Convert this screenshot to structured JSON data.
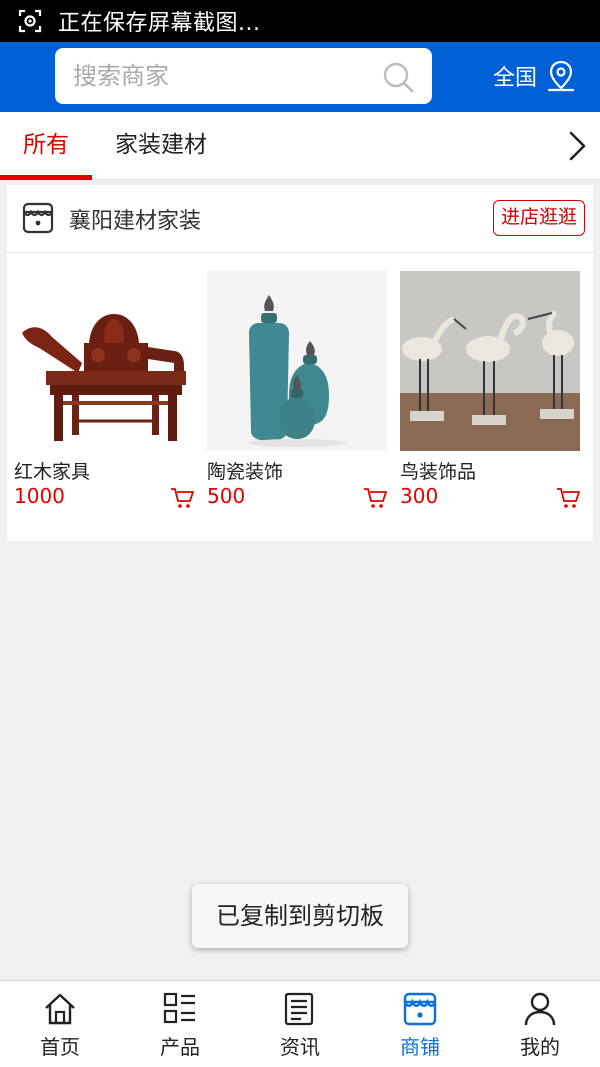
{
  "status_bar": {
    "text": "正在保存屏幕截图..."
  },
  "header": {
    "search_placeholder": "搜索商家",
    "region_label": "全国"
  },
  "tabs": [
    {
      "label": "所有",
      "active": true
    },
    {
      "label": "家装建材",
      "active": false
    }
  ],
  "shop": {
    "name": "襄阳建材家装",
    "visit_label": "进店逛逛",
    "products": [
      {
        "name": "红木家具",
        "price": "1000"
      },
      {
        "name": "陶瓷装饰",
        "price": "500"
      },
      {
        "name": "鸟装饰品",
        "price": "300"
      }
    ]
  },
  "toast": {
    "text": "已复制到剪切板"
  },
  "bottom_nav": [
    {
      "label": "首页",
      "icon": "home-icon"
    },
    {
      "label": "产品",
      "icon": "grid-list-icon"
    },
    {
      "label": "资讯",
      "icon": "news-icon"
    },
    {
      "label": "商铺",
      "icon": "store-icon",
      "active": true
    },
    {
      "label": "我的",
      "icon": "person-icon"
    }
  ],
  "colors": {
    "brand_blue": "#0061d6",
    "accent_red": "#e00000",
    "nav_active": "#0a70d8"
  }
}
